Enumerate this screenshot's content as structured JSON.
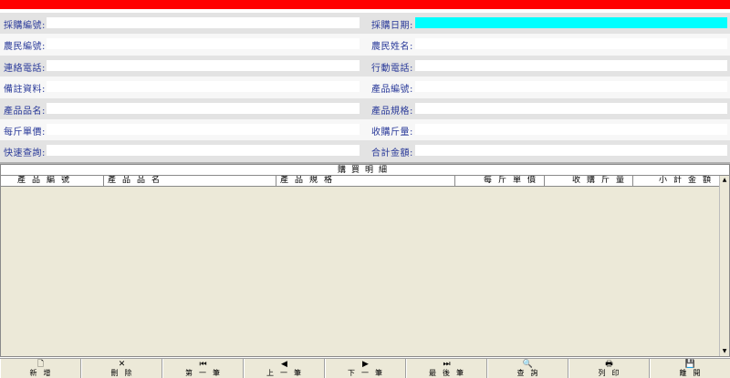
{
  "form": {
    "purchase_no_label": "採購編號:",
    "purchase_date_label": "採購日期:",
    "farmer_no_label": "農民編號:",
    "farmer_name_label": "農民姓名:",
    "phone_label": "連絡電話:",
    "mobile_label": "行動電話:",
    "remark_label": "備註資料:",
    "product_no_label": "產品編號:",
    "product_name_label": "產品品名:",
    "product_spec_label": "產品規格:",
    "unit_price_label": "每斤單價:",
    "qty_label": "收購斤量:",
    "quick_search_label": "快速查詢:",
    "total_label": "合計金額:"
  },
  "grid": {
    "title": "購買明細",
    "columns": [
      "產品編號",
      "產品品名",
      "產品規格",
      "每斤單價",
      "收購斤量",
      "小計金額"
    ]
  },
  "toolbar": {
    "buttons": [
      {
        "label": "新增",
        "icon": "new-file-icon",
        "glyph": "🗋"
      },
      {
        "label": "刪除",
        "icon": "delete-x-icon",
        "glyph": "✕"
      },
      {
        "label": "第一筆",
        "icon": "first-record-icon",
        "glyph": "⏮"
      },
      {
        "label": "上一筆",
        "icon": "prev-record-icon",
        "glyph": "◀"
      },
      {
        "label": "下一筆",
        "icon": "next-record-icon",
        "glyph": "▶"
      },
      {
        "label": "最後筆",
        "icon": "last-record-icon",
        "glyph": "⏭"
      },
      {
        "label": "查詢",
        "icon": "search-doc-icon",
        "glyph": "🔍"
      },
      {
        "label": "列印",
        "icon": "printer-icon",
        "glyph": "🖶"
      },
      {
        "label": "離開",
        "icon": "save-disk-icon",
        "glyph": "💾"
      }
    ]
  },
  "colors": {
    "top_bar": "#ff0000",
    "date_field": "#00ffff",
    "label_text": "#2a3a9a"
  }
}
